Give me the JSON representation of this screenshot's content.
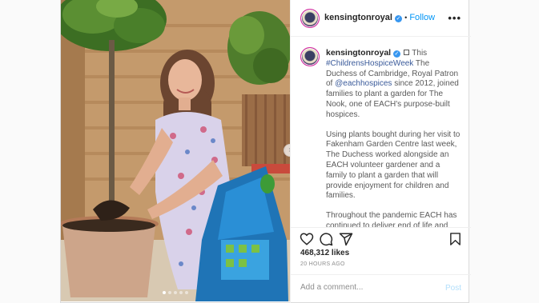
{
  "post": {
    "username": "kensingtonroyal",
    "follow_label": "Follow",
    "header_separator": "•",
    "more_label": "•••",
    "caption": {
      "username": "kensingtonroyal",
      "intro": "This",
      "hashtag": "#ChildrensHospiceWeek",
      "part1": "The Duchess of Cambridge, Royal Patron of",
      "mention": "@eachhospices",
      "part2": "since 2012, joined families to plant a garden for The Nook, one of EACH's purpose-built hospices.",
      "paragraph2": "Using plants bought during her visit to Fakenham Garden Centre last week, The Duchess worked alongside an EACH volunteer gardener and a family to plant a garden that will provide enjoyment for children and families.",
      "paragraph3": "Throughout the pandemic EACH has continued to deliver end of life and emergency crisis care as well as bereavement support."
    },
    "likes": "468,312 likes",
    "time": "20 HOURS AGO",
    "comment_placeholder": "Add a comment...",
    "post_label": "Post",
    "carousel": {
      "slides": 5,
      "active_index": 0
    },
    "icons": {
      "verified": "verified-badge-icon",
      "like": "heart-icon",
      "comment": "comment-icon",
      "share": "send-icon",
      "save": "bookmark-icon",
      "next": "chevron-right-icon"
    },
    "colors": {
      "accent": "#0095f6",
      "post_disabled": "#b2dffc",
      "verified": "#3897f0",
      "link": "#3a5a9a"
    }
  }
}
